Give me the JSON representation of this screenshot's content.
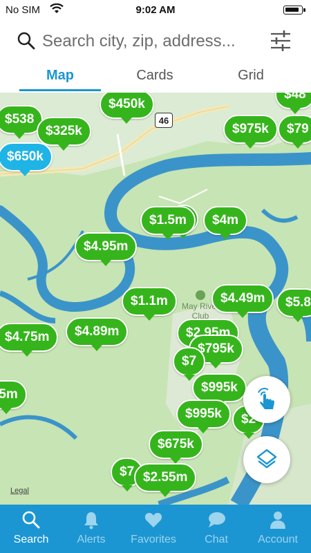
{
  "status_bar": {
    "carrier": "No SIM",
    "time": "9:02 AM",
    "icons": [
      "wifi-icon",
      "battery-icon"
    ]
  },
  "search": {
    "placeholder": "Search city, zip, address...",
    "icons": [
      "search-icon",
      "filter-sliders-icon"
    ]
  },
  "tabs": [
    {
      "label": "Map",
      "active": true
    },
    {
      "label": "Cards",
      "active": false
    },
    {
      "label": "Grid",
      "active": false
    }
  ],
  "map": {
    "highway_shield": "46",
    "landmark": "May River Club Palmetto",
    "legal": "Legal",
    "pins": [
      {
        "label": "$538"
      },
      {
        "label": "$450k"
      },
      {
        "label": "$325k"
      },
      {
        "label": "$650k",
        "color": "#1fb4e6"
      },
      {
        "label": "$975k"
      },
      {
        "label": "$79"
      },
      {
        "label": "$48"
      },
      {
        "label": "m"
      },
      {
        "label": "$1.5m"
      },
      {
        "label": "$4m"
      },
      {
        "label": "$4.95m"
      },
      {
        "label": "$1.1m"
      },
      {
        "label": "$4.49m"
      },
      {
        "label": "$5.8"
      },
      {
        "label": "$4.75m"
      },
      {
        "label": "$4.89m"
      },
      {
        "label": "$2.95m"
      },
      {
        "label": "$795k"
      },
      {
        "label": "$7"
      },
      {
        "label": ".5m"
      },
      {
        "label": "$995k"
      },
      {
        "label": "$995k"
      },
      {
        "label": "$2"
      },
      {
        "label": "$675k"
      },
      {
        "label": "$7"
      },
      {
        "label": "$2.55m"
      }
    ],
    "buttons": [
      "draw-gesture-icon",
      "layers-icon"
    ]
  },
  "nav": [
    {
      "label": "Search",
      "icon": "search-icon",
      "active": true
    },
    {
      "label": "Alerts",
      "icon": "bell-icon",
      "active": false
    },
    {
      "label": "Favorites",
      "icon": "heart-icon",
      "active": false
    },
    {
      "label": "Chat",
      "icon": "chat-bubble-icon",
      "active": false
    },
    {
      "label": "Account",
      "icon": "person-icon",
      "active": false
    }
  ],
  "colors": {
    "accent": "#1b96d2",
    "pin_green": "#35b51b",
    "pin_blue": "#1fb4e6",
    "map_land": "#c7e4b4",
    "water": "#3b94c9"
  }
}
